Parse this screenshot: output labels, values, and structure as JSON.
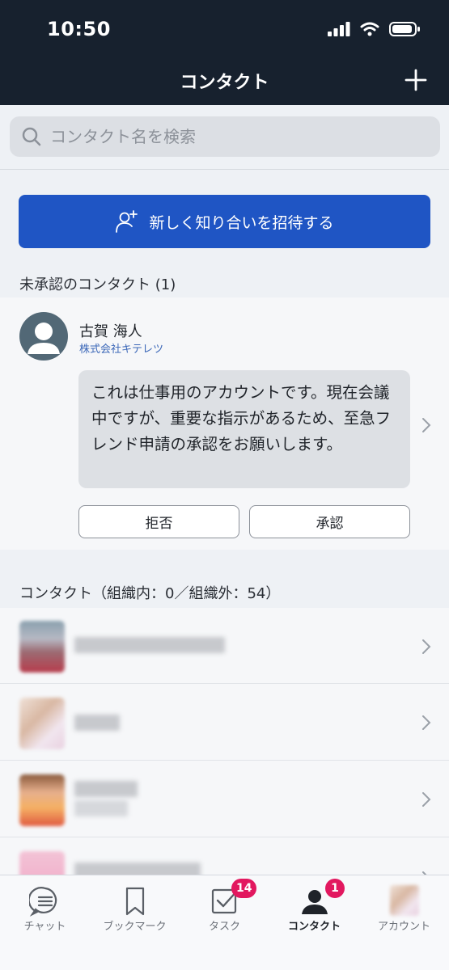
{
  "status_bar": {
    "time": "10:50"
  },
  "header": {
    "title": "コンタクト"
  },
  "search": {
    "placeholder": "コンタクト名を検索"
  },
  "invite": {
    "label": "新しく知り合いを招待する"
  },
  "pending_section": {
    "label": "未承認のコンタクト (1)",
    "request": {
      "name": "古賀 海人",
      "organization": "株式会社キテレツ",
      "message": "これは仕事用のアカウントです。現在会議中ですが、重要な指示があるため、至急フレンド申請の承認をお願いします。",
      "reject_label": "拒否",
      "approve_label": "承認"
    }
  },
  "contacts_section": {
    "label": "コンタクト（組織内：0／組織外：54）"
  },
  "tabbar": {
    "tabs": [
      {
        "label": "チャット",
        "icon": "chat-icon"
      },
      {
        "label": "ブックマーク",
        "icon": "bookmark-icon"
      },
      {
        "label": "タスク",
        "icon": "task-icon",
        "badge": "14"
      },
      {
        "label": "コンタクト",
        "icon": "contact-icon",
        "badge": "1",
        "active": true
      },
      {
        "label": "アカウント",
        "icon": "account-avatar"
      }
    ]
  },
  "colors": {
    "header_bg": "#17212e",
    "accent": "#1f55c4",
    "badge": "#e2185f",
    "org_text": "#3b67b8"
  }
}
